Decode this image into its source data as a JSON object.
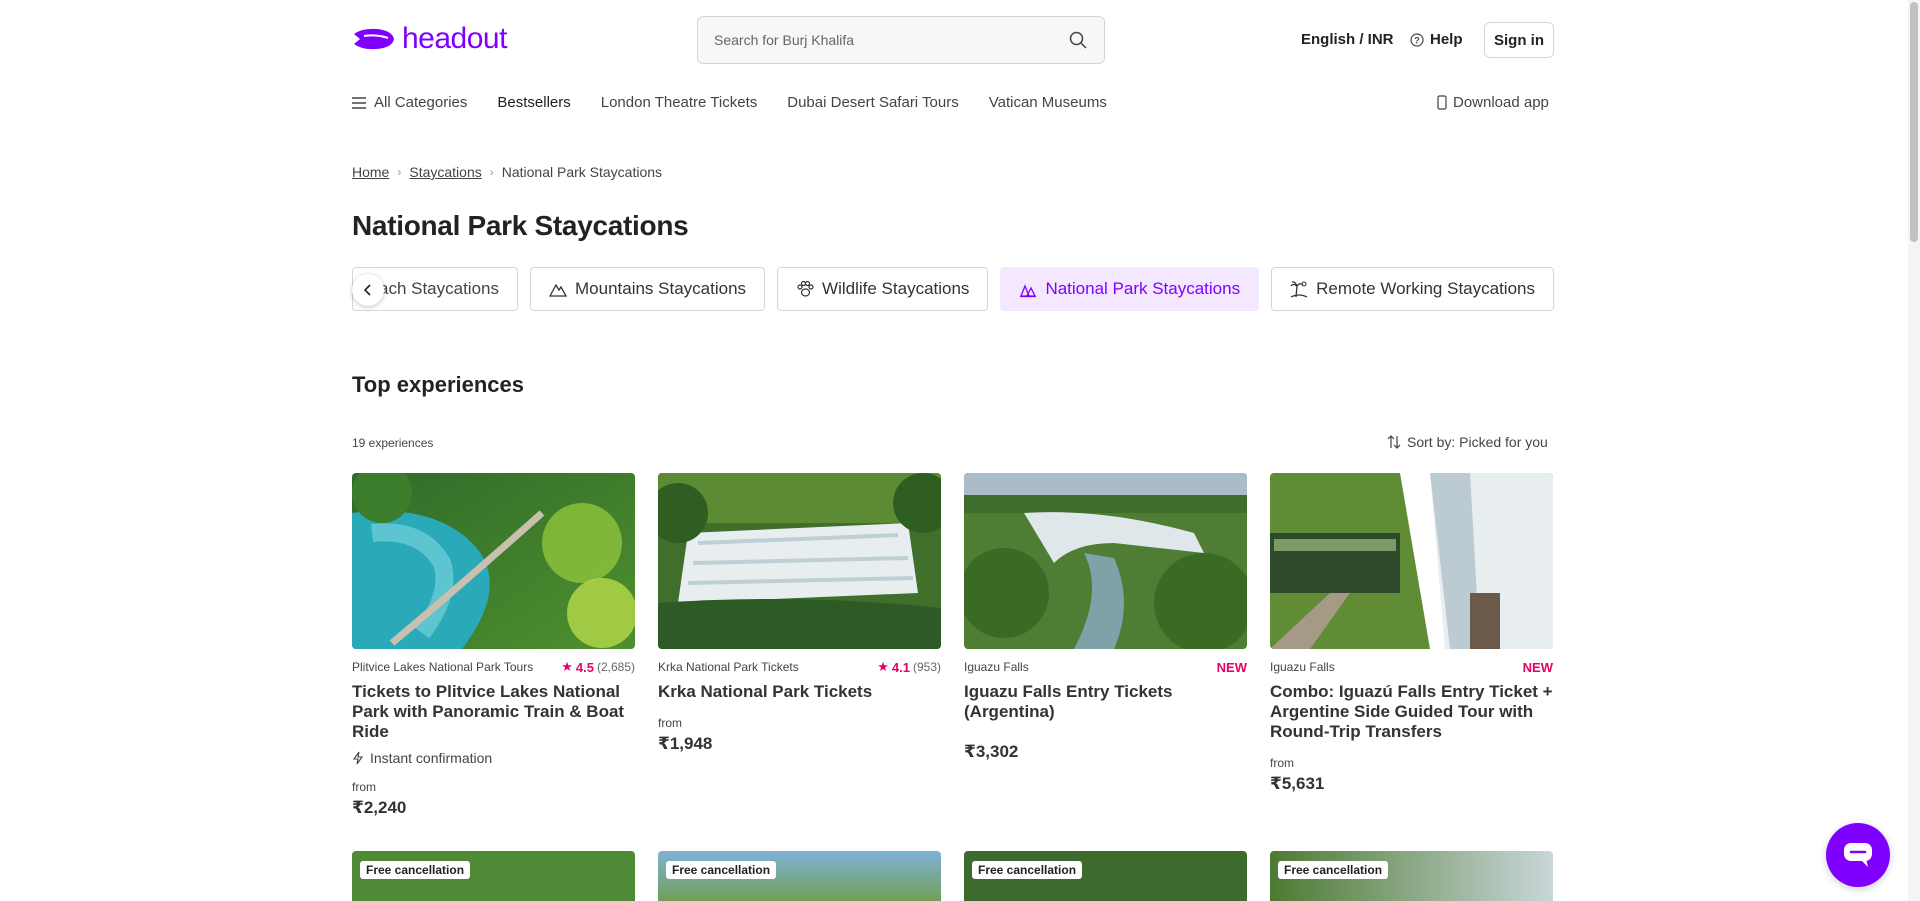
{
  "header": {
    "logo_text": "headout",
    "search_placeholder": "Search for Burj Khalifa",
    "language_currency": "English / INR",
    "help": "Help",
    "sign_in": "Sign in"
  },
  "nav": {
    "all_categories": "All Categories",
    "items": [
      "Bestsellers",
      "London Theatre Tickets",
      "Dubai Desert Safari Tours",
      "Vatican Museums"
    ],
    "download_app": "Download app"
  },
  "breadcrumb": [
    "Home",
    "Staycations",
    "National Park Staycations"
  ],
  "page_title": "National Park Staycations",
  "chips": [
    {
      "label": "Beach Staycations",
      "visible_label": "ach Staycations",
      "icon": "beach-icon",
      "active": false
    },
    {
      "label": "Mountains Staycations",
      "icon": "mountain-icon",
      "active": false
    },
    {
      "label": "Wildlife Staycations",
      "icon": "paw-icon",
      "active": false
    },
    {
      "label": "National Park Staycations",
      "icon": "park-icon",
      "active": true
    },
    {
      "label": "Remote Working Staycations",
      "icon": "island-icon",
      "active": false
    }
  ],
  "section": {
    "title": "Top experiences",
    "count": "19 experiences",
    "sort": "Sort by: Picked for you"
  },
  "cards": [
    {
      "category": "Plitvice Lakes National Park Tours",
      "rating": "4.5",
      "reviews": "(2,685)",
      "new": "",
      "title": "Tickets to Plitvice Lakes National Park with Panoramic Train & Boat Ride",
      "instant": "Instant confirmation",
      "from": "from",
      "price": "₹2,240"
    },
    {
      "category": "Krka National Park Tickets",
      "rating": "4.1",
      "reviews": "(953)",
      "new": "",
      "title": "Krka National Park Tickets",
      "instant": "",
      "from": "from",
      "price": "₹1,948"
    },
    {
      "category": "Iguazu Falls",
      "rating": "",
      "reviews": "",
      "new": "NEW",
      "title": "Iguazu Falls Entry Tickets (Argentina)",
      "instant": "",
      "from": "",
      "price": "₹3,302"
    },
    {
      "category": "Iguazu Falls",
      "rating": "",
      "reviews": "",
      "new": "NEW",
      "title": "Combo: Iguazú Falls Entry Ticket + Argentine Side Guided Tour with Round-Trip Transfers",
      "instant": "",
      "from": "from",
      "price": "₹5,631"
    }
  ],
  "row2_badges": [
    "Free cancellation",
    "Free cancellation",
    "Free cancellation",
    "Free cancellation"
  ],
  "colors": {
    "brand": "#8000ff",
    "rating": "#e5006a",
    "chip_active_bg": "#f3e8ff"
  }
}
